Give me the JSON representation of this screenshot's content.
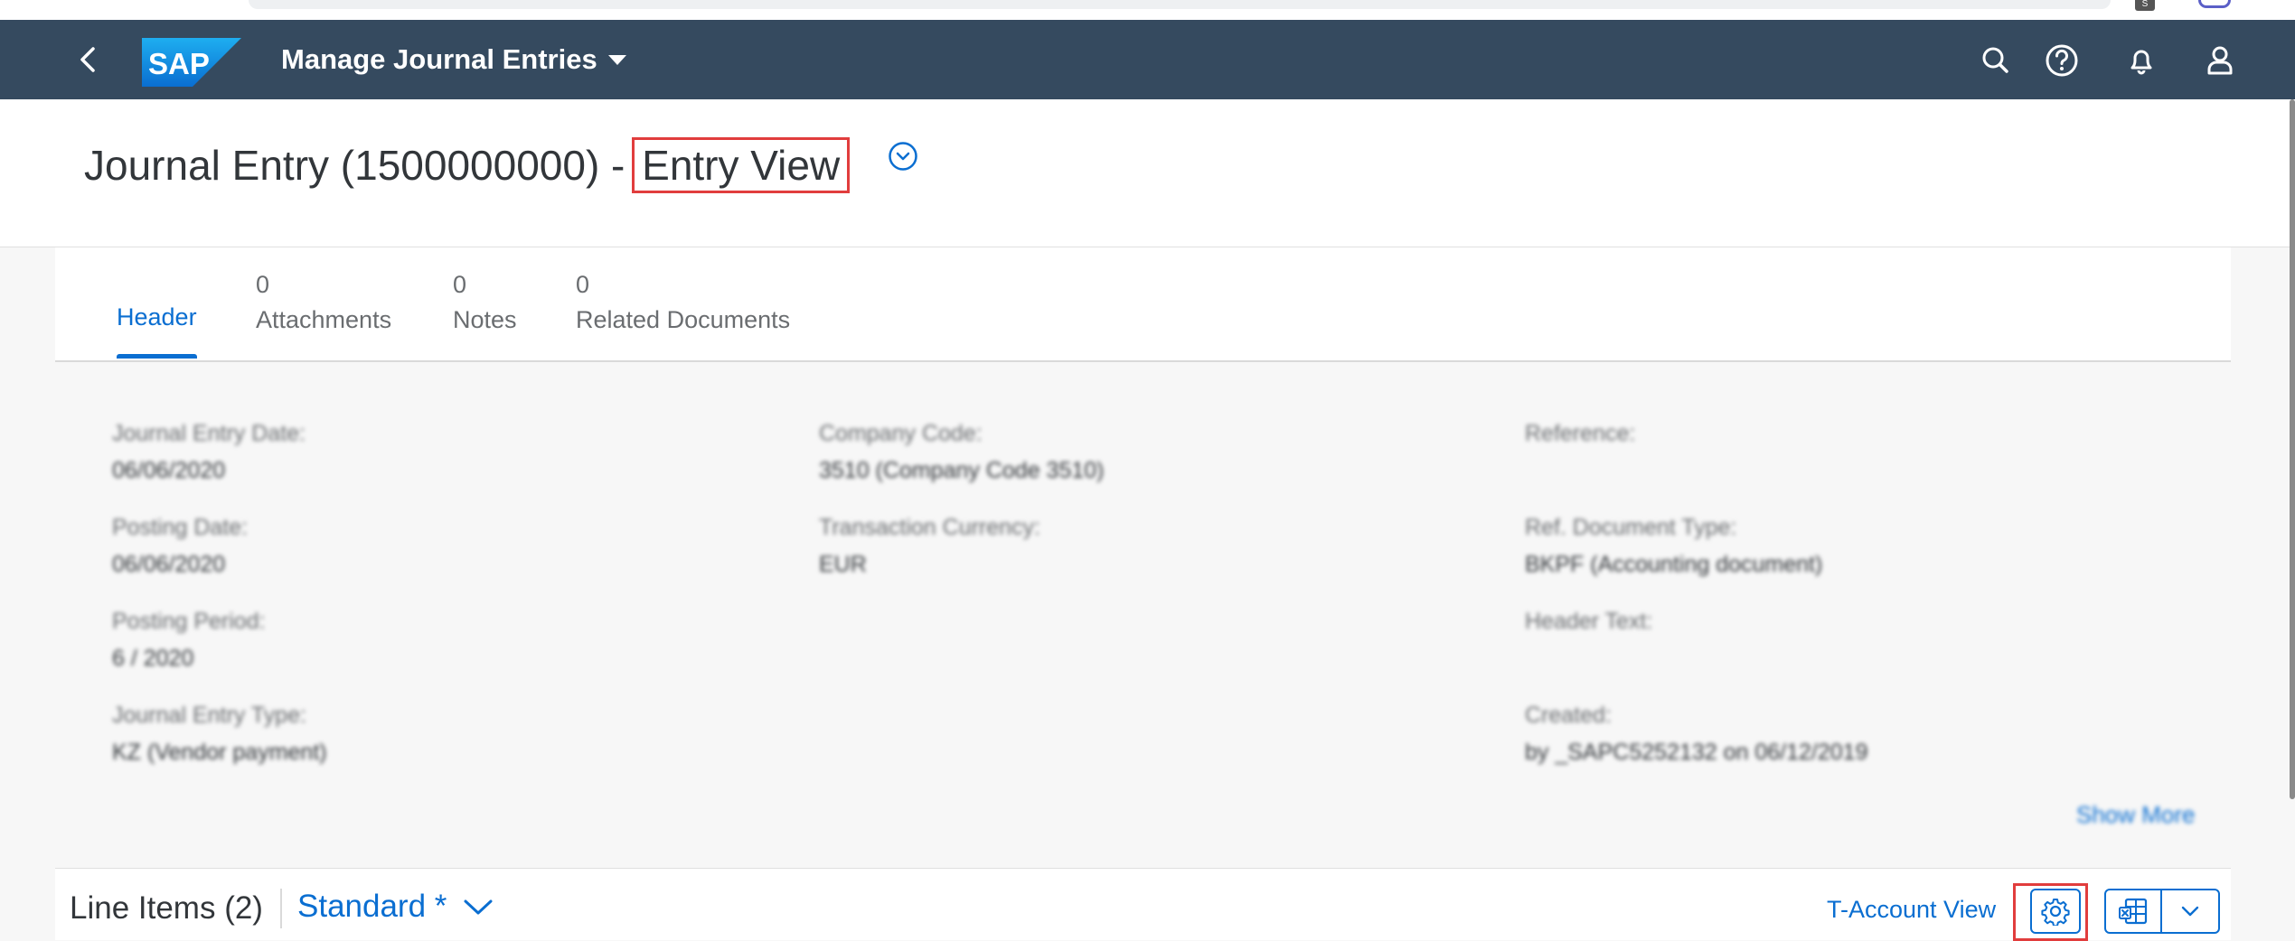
{
  "browser": {
    "extension_badge": "S"
  },
  "shell": {
    "app_title": "Manage Journal Entries"
  },
  "object": {
    "title_prefix": "Journal Entry (1500000000) -",
    "title_highlight": "Entry View"
  },
  "tabs": [
    {
      "count": "",
      "label": "Header"
    },
    {
      "count": "0",
      "label": "Attachments"
    },
    {
      "count": "0",
      "label": "Notes"
    },
    {
      "count": "0",
      "label": "Related Documents"
    }
  ],
  "header_fields": {
    "journal_entry_date": {
      "label": "Journal Entry Date:",
      "value": "06/06/2020"
    },
    "posting_date": {
      "label": "Posting Date:",
      "value": "06/06/2020"
    },
    "posting_period": {
      "label": "Posting Period:",
      "value": "6 / 2020"
    },
    "journal_entry_type": {
      "label": "Journal Entry Type:",
      "value": "KZ (Vendor payment)"
    },
    "company_code": {
      "label": "Company Code:",
      "value": "3510 (Company Code 3510)"
    },
    "transaction_currency": {
      "label": "Transaction Currency:",
      "value": "EUR"
    },
    "reference": {
      "label": "Reference:",
      "value": ""
    },
    "ref_document_type": {
      "label": "Ref. Document Type:",
      "value": "BKPF (Accounting document)"
    },
    "header_text": {
      "label": "Header Text:",
      "value": ""
    },
    "created": {
      "label": "Created:",
      "value": "by _SAPC5252132 on 06/12/2019"
    },
    "show_more": "Show More"
  },
  "line_items": {
    "title": "Line Items (2)",
    "variant": "Standard *",
    "t_account_view": "T-Account View"
  },
  "icons": {
    "back": "back-arrow-icon",
    "search": "search-icon",
    "help": "help-icon",
    "notifications": "bell-icon",
    "user": "user-icon",
    "expand": "circle-chevron-down-icon",
    "settings": "gear-icon",
    "export": "spreadsheet-export-icon",
    "dropdown": "chevron-down-icon"
  },
  "colors": {
    "shell_bar": "#354a5f",
    "accent": "#0a6ed1",
    "highlight_box": "#e13d3d",
    "background": "#f7f7f7"
  }
}
